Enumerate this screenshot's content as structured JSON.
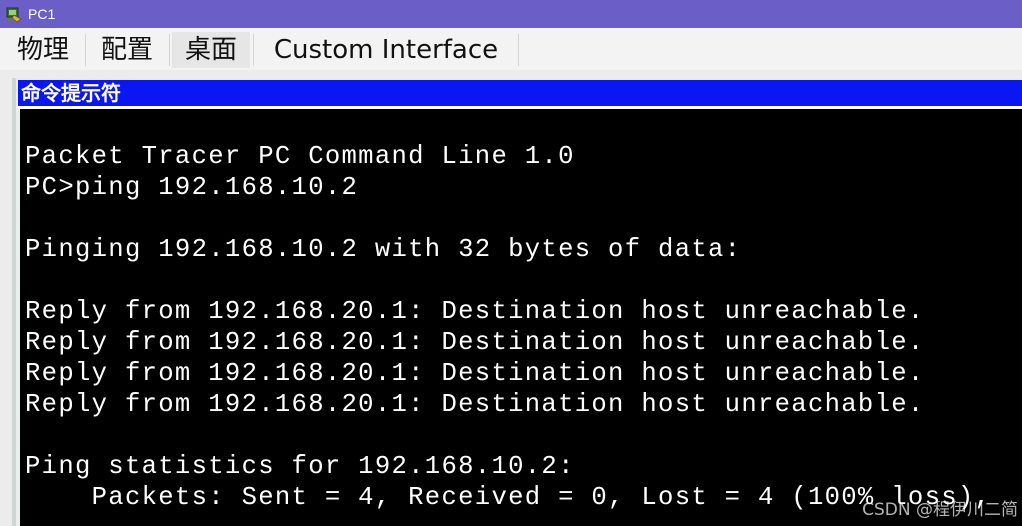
{
  "window": {
    "title": "PC1",
    "title_color": "#6b5fc7"
  },
  "tabs": [
    {
      "label": "物理"
    },
    {
      "label": "配置"
    },
    {
      "label": "桌面",
      "active": true
    },
    {
      "label": "Custom Interface"
    }
  ],
  "panel": {
    "header": "命令提示符",
    "header_color": "#0b17f2"
  },
  "terminal": {
    "background": "#000000",
    "text_color": "#ffffff",
    "lines": [
      "",
      "Packet Tracer PC Command Line 1.0",
      "PC>ping 192.168.10.2",
      "",
      "Pinging 192.168.10.2 with 32 bytes of data:",
      "",
      "Reply from 192.168.20.1: Destination host unreachable.",
      "Reply from 192.168.20.1: Destination host unreachable.",
      "Reply from 192.168.20.1: Destination host unreachable.",
      "Reply from 192.168.20.1: Destination host unreachable.",
      "",
      "Ping statistics for 192.168.10.2:",
      "    Packets: Sent = 4, Received = 0, Lost = 4 (100% loss),"
    ]
  },
  "watermark": "CSDN @程伊川二简"
}
